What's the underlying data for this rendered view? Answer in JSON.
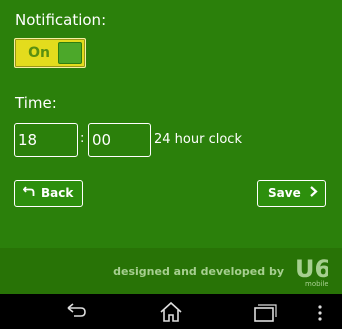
{
  "notification": {
    "label": "Notification:",
    "toggle_value": "On"
  },
  "time": {
    "label": "Time:",
    "hour": "18",
    "separator": ":",
    "minute": "00",
    "format_note": "24 hour clock"
  },
  "actions": {
    "back_label": "Back",
    "save_label": "Save"
  },
  "footer": {
    "credit": "designed and developed by",
    "logo_text": "U6",
    "logo_sub": "mobile"
  },
  "colors": {
    "background": "#2b800b",
    "toggle": "#e3dc1d",
    "footer": "#287306"
  },
  "icons": {
    "back": "return-arrow-icon",
    "save": "chevron-right-icon",
    "nav": [
      "back-icon",
      "home-icon",
      "recent-apps-icon",
      "overflow-menu-icon"
    ]
  }
}
